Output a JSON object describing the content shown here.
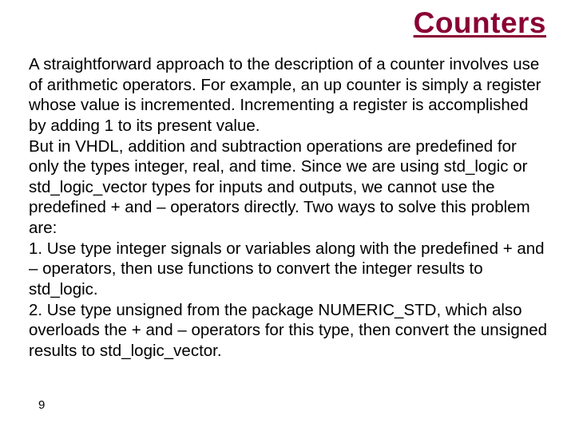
{
  "title": "Counters",
  "body": "A straightforward approach to the description of a counter involves use of arithmetic operators. For example, an up counter is simply a register whose value is incremented. Incrementing a register is accomplished by adding 1 to its present value.\nBut in VHDL, addition and subtraction operations are predefined for only the types integer, real, and time. Since we are using std_logic or std_logic_vector types for inputs and outputs, we cannot use the predefined + and – operators directly. Two ways to solve this problem are:\n1. Use type integer signals or variables along with the predefined + and – operators, then use functions to convert the integer results to std_logic.\n2. Use type unsigned from the package NUMERIC_STD, which also overloads the + and – operators for this type, then convert the unsigned results to std_logic_vector.",
  "page_number": "9"
}
